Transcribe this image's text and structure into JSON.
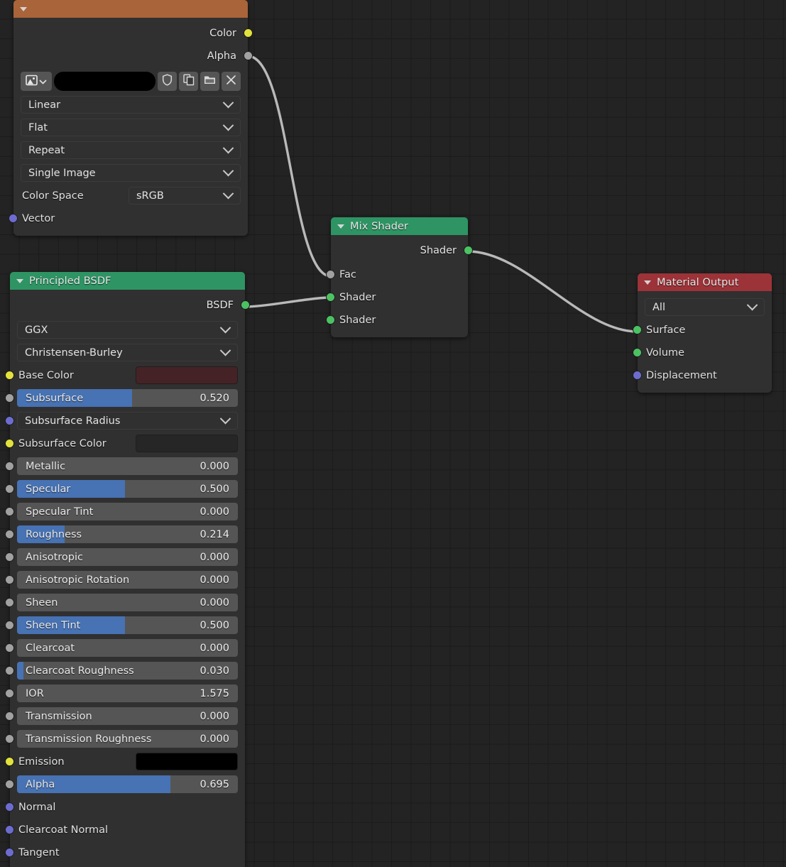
{
  "editor": {
    "name": "shader-node-editor",
    "background": "#232323",
    "grid_color": "#1b1b1b"
  },
  "colors": {
    "header_image_texture": "#a9643a",
    "header_shader": "#2e9464",
    "header_output": "#9c3338",
    "socket_color": "#e2e23c",
    "socket_value": "#a1a1a1",
    "socket_vector": "#6c6cd0",
    "socket_shader": "#4cc263",
    "slider_fill": "#4772b3",
    "noodle": "#b9b9b9"
  },
  "nodes": {
    "image_texture": {
      "title": "",
      "outputs": [
        {
          "label": "Color",
          "socket": "color"
        },
        {
          "label": "Alpha",
          "socket": "value"
        }
      ],
      "image_toolbar": {
        "browse_icon": "image-browse-icon",
        "browse_chevron": "chevron-down-icon",
        "name_value": "",
        "fake_user_icon": "shield-icon",
        "new_image_icon": "copy-icon",
        "open_image_icon": "folder-icon",
        "unlink_icon": "close-icon"
      },
      "dropdowns": [
        {
          "name": "interpolation",
          "value": "Linear"
        },
        {
          "name": "projection",
          "value": "Flat"
        },
        {
          "name": "extension",
          "value": "Repeat"
        },
        {
          "name": "source",
          "value": "Single Image"
        }
      ],
      "color_space": {
        "label": "Color Space",
        "value": "sRGB"
      },
      "inputs": [
        {
          "label": "Vector",
          "socket": "vector"
        }
      ]
    },
    "principled_bsdf": {
      "title": "Principled BSDF",
      "outputs": [
        {
          "label": "BSDF",
          "socket": "shader"
        }
      ],
      "dropdowns": [
        {
          "name": "distribution",
          "value": "GGX"
        },
        {
          "name": "subsurface-method",
          "value": "Christensen-Burley"
        }
      ],
      "properties": [
        {
          "label": "Base Color",
          "type": "color",
          "socket": "color",
          "color": "#452226"
        },
        {
          "label": "Subsurface",
          "type": "slider",
          "socket": "value",
          "value": "0.520",
          "fill": 52.0
        },
        {
          "label": "Subsurface Radius",
          "type": "dropdown",
          "socket": "vector"
        },
        {
          "label": "Subsurface Color",
          "type": "color",
          "socket": "color",
          "color": "#262626"
        },
        {
          "label": "Metallic",
          "type": "slider",
          "socket": "value",
          "value": "0.000",
          "fill": 0
        },
        {
          "label": "Specular",
          "type": "slider",
          "socket": "value",
          "value": "0.500",
          "fill": 49.0
        },
        {
          "label": "Specular Tint",
          "type": "slider",
          "socket": "value",
          "value": "0.000",
          "fill": 0
        },
        {
          "label": "Roughness",
          "type": "slider",
          "socket": "value",
          "value": "0.214",
          "fill": 21.4
        },
        {
          "label": "Anisotropic",
          "type": "slider",
          "socket": "value",
          "value": "0.000",
          "fill": 0
        },
        {
          "label": "Anisotropic Rotation",
          "type": "slider",
          "socket": "value",
          "value": "0.000",
          "fill": 0
        },
        {
          "label": "Sheen",
          "type": "slider",
          "socket": "value",
          "value": "0.000",
          "fill": 0
        },
        {
          "label": "Sheen Tint",
          "type": "slider",
          "socket": "value",
          "value": "0.500",
          "fill": 49.0
        },
        {
          "label": "Clearcoat",
          "type": "slider",
          "socket": "value",
          "value": "0.000",
          "fill": 0
        },
        {
          "label": "Clearcoat Roughness",
          "type": "slider",
          "socket": "value",
          "value": "0.030",
          "fill": 3.0
        },
        {
          "label": "IOR",
          "type": "slider",
          "socket": "value",
          "value": "1.575",
          "fill": 0
        },
        {
          "label": "Transmission",
          "type": "slider",
          "socket": "value",
          "value": "0.000",
          "fill": 0
        },
        {
          "label": "Transmission Roughness",
          "type": "slider",
          "socket": "value",
          "value": "0.000",
          "fill": 0
        },
        {
          "label": "Emission",
          "type": "color",
          "socket": "color",
          "color": "#000000"
        },
        {
          "label": "Alpha",
          "type": "slider",
          "socket": "value",
          "value": "0.695",
          "fill": 69.5
        },
        {
          "label": "Normal",
          "type": "socketonly",
          "socket": "vector"
        },
        {
          "label": "Clearcoat Normal",
          "type": "socketonly",
          "socket": "vector"
        },
        {
          "label": "Tangent",
          "type": "socketonly",
          "socket": "vector"
        }
      ]
    },
    "mix_shader": {
      "title": "Mix Shader",
      "outputs": [
        {
          "label": "Shader",
          "socket": "shader"
        }
      ],
      "inputs": [
        {
          "label": "Fac",
          "socket": "value"
        },
        {
          "label": "Shader",
          "socket": "shader"
        },
        {
          "label": "Shader",
          "socket": "shader"
        }
      ]
    },
    "material_output": {
      "title": "Material Output",
      "target": {
        "name": "target",
        "value": "All"
      },
      "inputs": [
        {
          "label": "Surface",
          "socket": "shader"
        },
        {
          "label": "Volume",
          "socket": "shader"
        },
        {
          "label": "Displacement",
          "socket": "vector"
        }
      ]
    }
  },
  "links": [
    {
      "from": "image-texture.Alpha",
      "to": "mix-shader.Fac"
    },
    {
      "from": "principled-bsdf.BSDF",
      "to": "mix-shader.Shader"
    },
    {
      "from": "mix-shader.Shader",
      "to": "material-output.Surface"
    }
  ]
}
